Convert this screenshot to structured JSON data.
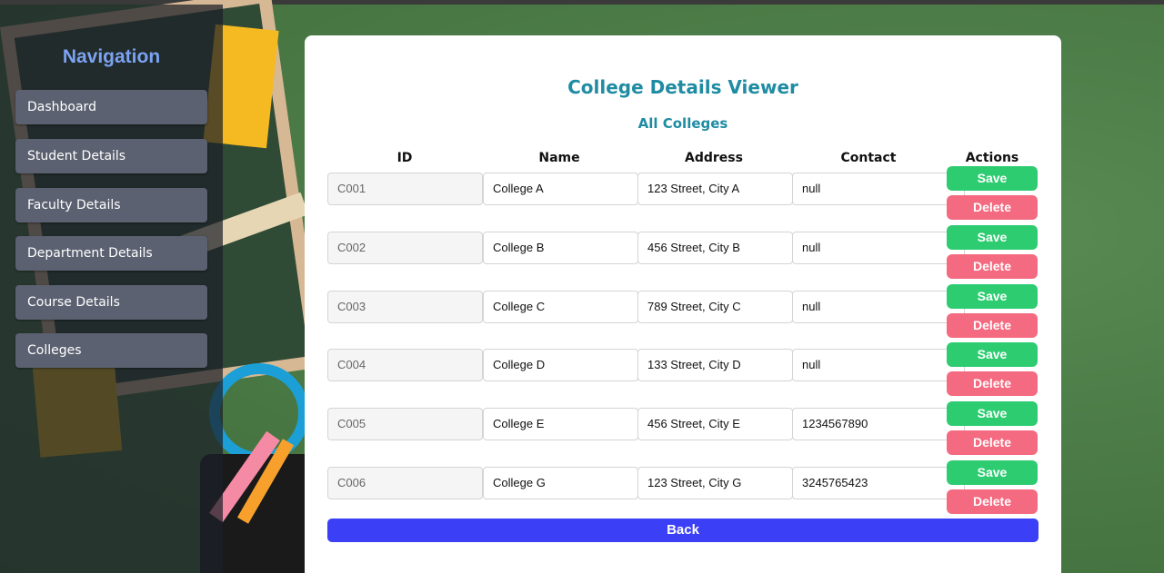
{
  "sidebar": {
    "title": "Navigation",
    "items": [
      "Dashboard",
      "Student Details",
      "Faculty Details",
      "Department Details",
      "Course Details",
      "Colleges"
    ]
  },
  "main": {
    "title": "College Details Viewer",
    "subtitle": "All Colleges",
    "columns": [
      "ID",
      "Name",
      "Address",
      "Contact",
      "Actions"
    ],
    "rows": [
      {
        "id": "C001",
        "name": "College A",
        "address": "123 Street, City A",
        "contact": "null"
      },
      {
        "id": "C002",
        "name": "College B",
        "address": "456 Street, City B",
        "contact": "null"
      },
      {
        "id": "C003",
        "name": "College C",
        "address": "789 Street, City C",
        "contact": "null"
      },
      {
        "id": "C004",
        "name": "College D",
        "address": "133 Street, City D",
        "contact": "null"
      },
      {
        "id": "C005",
        "name": "College E",
        "address": "456 Street, City E",
        "contact": "1234567890"
      },
      {
        "id": "C006",
        "name": "College G",
        "address": "123 Street, City G",
        "contact": "3245765423"
      }
    ],
    "save_label": "Save",
    "delete_label": "Delete",
    "back_label": "Back"
  },
  "colors": {
    "accent": "#1f8ca3",
    "save": "#2ecc71",
    "delete": "#f46a80",
    "back": "#3b3ff5",
    "nav_title": "#7ba3f2"
  }
}
